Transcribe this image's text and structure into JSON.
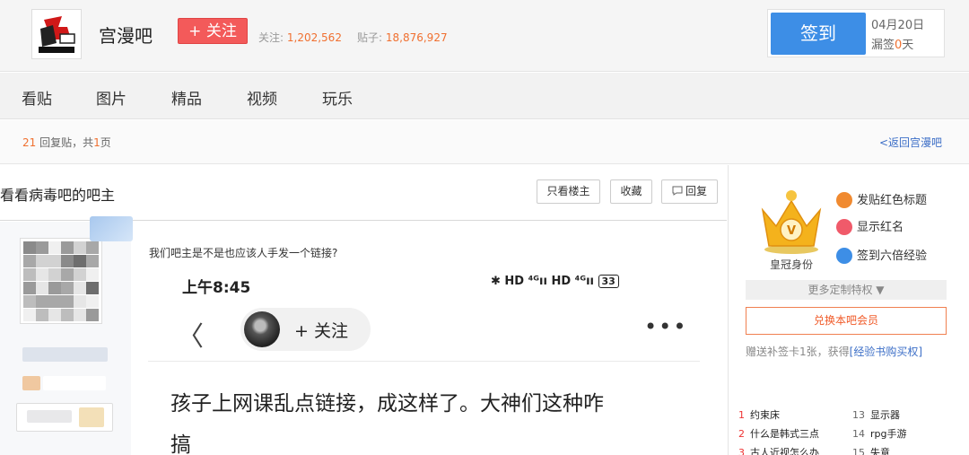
{
  "header": {
    "bar_name": "宫漫吧",
    "follow_label": "+ 关注",
    "stat_follow_label": "关注:",
    "stat_follow_value": "1,202,562",
    "stat_posts_label": "贴子:",
    "stat_posts_value": "18,876,927",
    "sign_label": "签到",
    "sign_date": "04月20日",
    "sign_missed_label": "漏签",
    "sign_missed_value": "0",
    "sign_missed_unit": "天"
  },
  "nav": {
    "items": [
      "看贴",
      "图片",
      "精品",
      "视频",
      "玩乐"
    ]
  },
  "strip": {
    "reply_count": "21",
    "reply_label": "回复贴，共",
    "page_count": "1",
    "page_label": "页",
    "back_link": "<返回宫漫吧"
  },
  "thread": {
    "title": "看看病毒吧的吧主",
    "only_op_label": "只看楼主",
    "favorite_label": "收藏",
    "reply_label": "回复",
    "post_text": "我们吧主是不是也应该人手发一个链接?"
  },
  "screenshot": {
    "time": "上午8:45",
    "status": "✱ HD ⁴ᴳıı HD ⁴ᴳıı",
    "battery": "33",
    "back": "〈",
    "follow": "+ 关注",
    "more": "•••",
    "headline_1": "孩子上网课乱点链接，成这样了。大神们这种咋",
    "headline_2": "搞"
  },
  "sidebar": {
    "crown_label": "皇冠身份",
    "perks": [
      {
        "label": "发贴红色标题",
        "color": "#f08a30"
      },
      {
        "label": "显示红名",
        "color": "#f05a6a"
      },
      {
        "label": "签到六倍经验",
        "color": "#3d8ee6"
      }
    ],
    "more_privileges": "更多定制特权 ▼",
    "exchange_label": "兑换本吧会员",
    "gift_text": "赠送补签卡1张，获得",
    "gift_link": "[经验书购买权]",
    "hot": [
      {
        "idx": "1",
        "label": "约束床"
      },
      {
        "idx": "13",
        "label": "显示器"
      },
      {
        "idx": "2",
        "label": "什么是韩式三点"
      },
      {
        "idx": "14",
        "label": "rpg手游"
      },
      {
        "idx": "3",
        "label": "古人近视怎么办"
      },
      {
        "idx": "15",
        "label": "失意"
      }
    ]
  },
  "colors": {
    "accent_blue": "#3d8ee6",
    "follow_red": "#f35a5a",
    "number_orange": "#f07030",
    "link_blue": "#3d6fc7"
  }
}
